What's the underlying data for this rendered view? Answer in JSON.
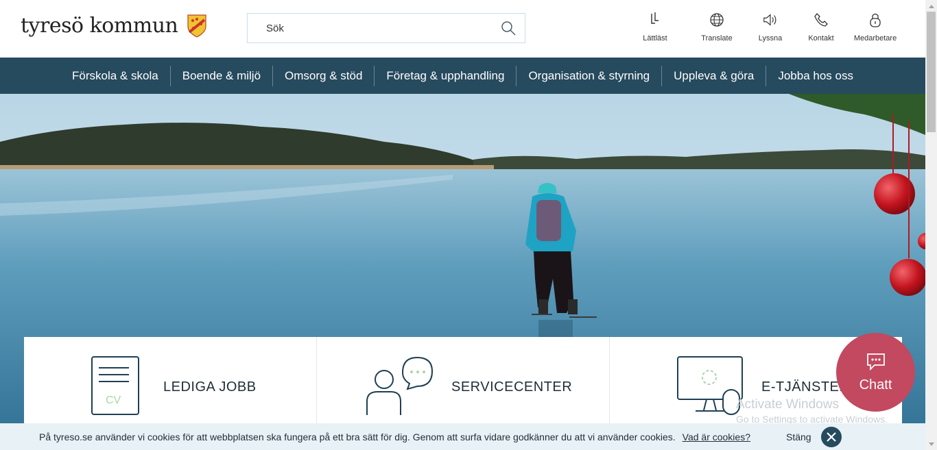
{
  "header": {
    "logo_text": "tyresö kommun",
    "search_placeholder": "Sök",
    "tools": [
      {
        "label": "Lättläst",
        "icon": "easy-read-icon"
      },
      {
        "label": "Translate",
        "icon": "globe-icon"
      },
      {
        "label": "Lyssna",
        "icon": "speaker-icon"
      },
      {
        "label": "Kontakt",
        "icon": "phone-icon"
      },
      {
        "label": "Medarbetare",
        "icon": "lock-icon"
      }
    ]
  },
  "nav": {
    "items": [
      "Förskola & skola",
      "Boende & miljö",
      "Omsorg & stöd",
      "Företag & upphandling",
      "Organisation & styrning",
      "Uppleva & göra",
      "Jobba hos oss"
    ]
  },
  "cards": [
    {
      "title": "LEDIGA JOBB",
      "icon": "cv-document-icon",
      "icon_text": "CV"
    },
    {
      "title": "SERVICECENTER",
      "icon": "person-chat-icon"
    },
    {
      "title": "E-TJÄNSTER",
      "icon": "computer-mouse-icon"
    }
  ],
  "chat": {
    "label": "Chatt",
    "icon": "chat-bubble-icon"
  },
  "watermark": {
    "line1": "Activate Windows",
    "line2": "Go to Settings to activate Windows."
  },
  "cookie": {
    "text": "På tyreso.se använder vi cookies för att webbplatsen ska fungera på ett bra sätt för dig. Genom att surfa vidare godkänner du att vi använder cookies.",
    "link": "Vad är cookies?",
    "close_label": "Stäng"
  },
  "colors": {
    "nav_bg": "#264a5e",
    "chat_bg": "#c2495f",
    "cookie_bg": "#e8f1f5"
  }
}
